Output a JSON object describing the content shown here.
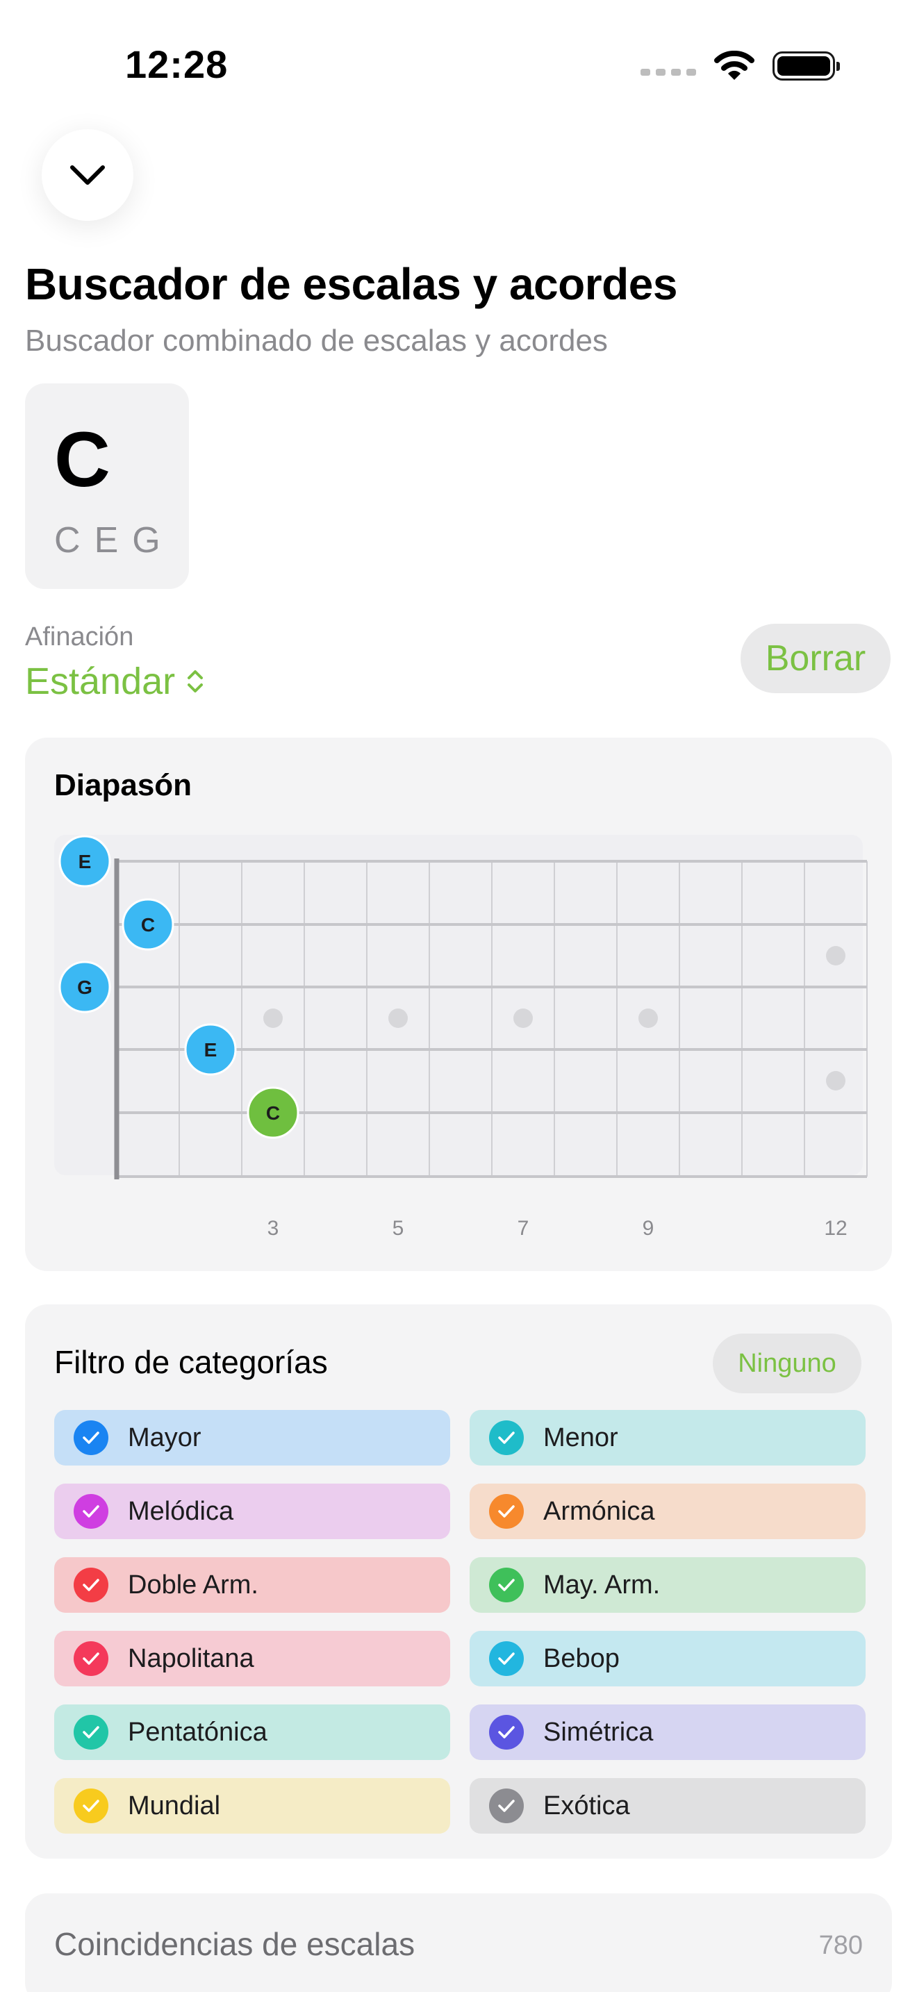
{
  "status_bar": {
    "time": "12:28",
    "icons": [
      "cellular-signal-icon",
      "wifi-icon",
      "battery-icon"
    ]
  },
  "header": {
    "dismiss_icon": "chevron-down-icon",
    "title": "Buscador de escalas y acordes",
    "subtitle": "Buscador combinado de escalas y acordes"
  },
  "chord": {
    "name": "C",
    "notes": [
      "C",
      "E",
      "G"
    ]
  },
  "tuning": {
    "label": "Afinación",
    "value": "Estándar",
    "icon": "up-down-chevron-icon"
  },
  "clear_button": "Borrar",
  "fretboard": {
    "title": "Diapasón",
    "fret_numbers": [
      "3",
      "5",
      "7",
      "9",
      "12"
    ],
    "notes": [
      {
        "label": "E",
        "string": 1,
        "fret": 0,
        "color": "#3bb8f3"
      },
      {
        "label": "C",
        "string": 2,
        "fret": 1,
        "color": "#3bb8f3"
      },
      {
        "label": "G",
        "string": 3,
        "fret": 0,
        "color": "#3bb8f3"
      },
      {
        "label": "E",
        "string": 4,
        "fret": 2,
        "color": "#3bb8f3"
      },
      {
        "label": "C",
        "string": 5,
        "fret": 3,
        "color": "#6fbf3f"
      }
    ]
  },
  "filter": {
    "title": "Filtro de categorías",
    "none_button": "Ninguno",
    "categories": [
      {
        "label": "Mayor",
        "bg": "#c5dff7",
        "check": "#1a84f2",
        "checked": true
      },
      {
        "label": "Menor",
        "bg": "#c4e9ea",
        "check": "#1fbcc9",
        "checked": true
      },
      {
        "label": "Melódica",
        "bg": "#ebcdee",
        "check": "#cf3ee1",
        "checked": true
      },
      {
        "label": "Armónica",
        "bg": "#f6dccb",
        "check": "#f7892d",
        "checked": true
      },
      {
        "label": "Doble Arm.",
        "bg": "#f6c8ca",
        "check": "#f33d45",
        "checked": true
      },
      {
        "label": "May. Arm.",
        "bg": "#cfe9d4",
        "check": "#3fc05a",
        "checked": true
      },
      {
        "label": "Napolitana",
        "bg": "#f6cbd3",
        "check": "#f4395b",
        "checked": true
      },
      {
        "label": "Bebop",
        "bg": "#c4e8f0",
        "check": "#22b6df",
        "checked": true
      },
      {
        "label": "Pentatónica",
        "bg": "#c3eae3",
        "check": "#21c6a7",
        "checked": true
      },
      {
        "label": "Simétrica",
        "bg": "#d6d5f2",
        "check": "#5b55e1",
        "checked": true
      },
      {
        "label": "Mundial",
        "bg": "#f5ecc6",
        "check": "#f8cb1e",
        "checked": true
      },
      {
        "label": "Exótica",
        "bg": "#e0e0e1",
        "check": "#8c8c91",
        "checked": true
      }
    ]
  },
  "matches": {
    "title": "Coincidencias de escalas",
    "count": "780"
  }
}
